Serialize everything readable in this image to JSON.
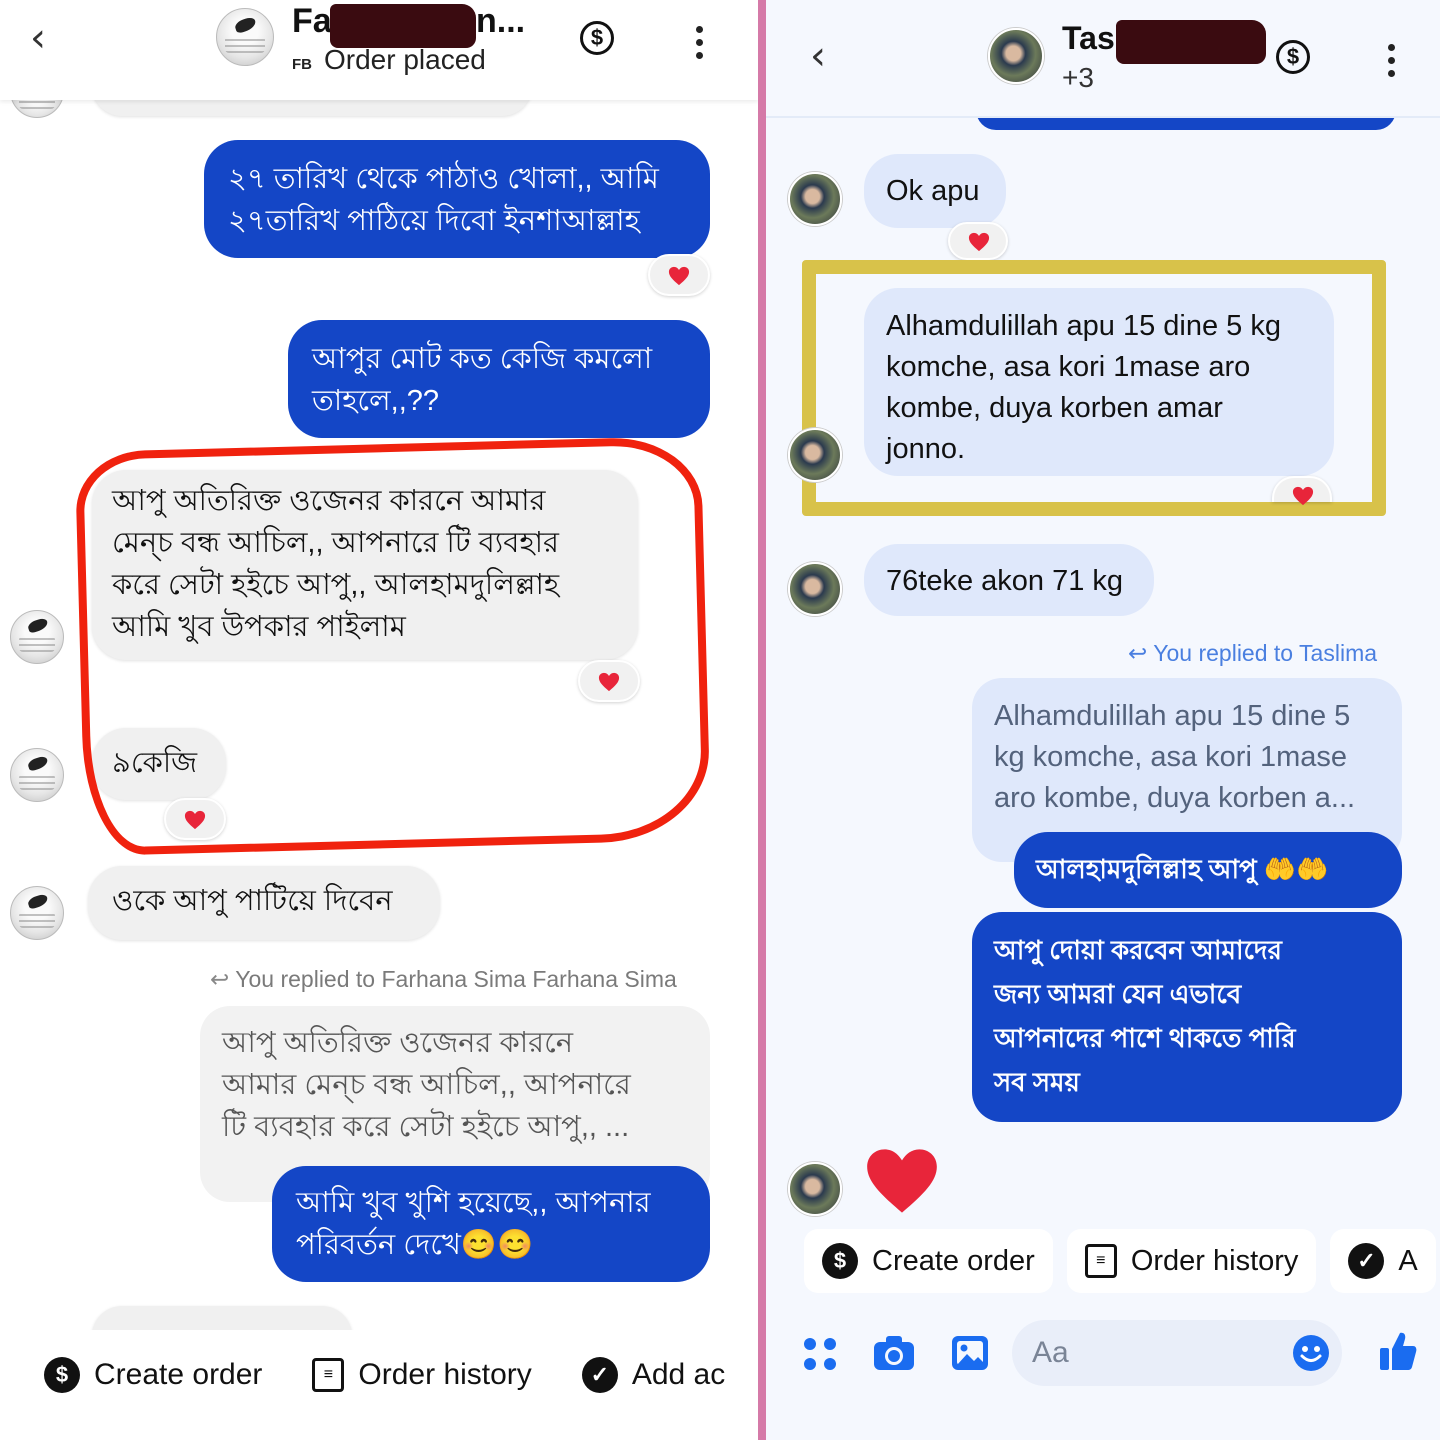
{
  "left": {
    "header": {
      "title": "Fa",
      "title_tail": "n...",
      "subtitle_prefix": "FB",
      "subtitle": "Order placed"
    },
    "messages": {
      "m1": "২৭ তারিখ থেকে পাঠাও খোলা,, আমি\n২৭তারিখ পাঠিয়ে দিবো ইনশাআল্লাহ",
      "m2": "আপুর মোট কত কেজি কমলো\nতাহলে,,??",
      "m3": "আপু অতিরিক্ত  ওজেনর কারনে আমার\nমেন্চ বন্ধ  আচিল,, আপনারে টি ব্যবহার\nকরে সেটা হইচে আপু,, আলহামদুলিল্লাহ\nআমি খুব উপকার পাইলাম",
      "m4": "৯কেজি",
      "m5": "ওকে আপু পাটিয়ে দিবেন",
      "reply_note": "You replied to Farhana Sima Farhana Sima",
      "quoted": "আপু অতিরিক্ত  ওজেনর কারনে\nআমার মেন্চ বন্ধ  আচিল,, আপনারে\nটি ব্যবহার করে সেটা হইচে আপু,, ...",
      "m6": "আমি খুব খুশি হয়েছে,, আপনার\nপরিবর্তন দেখে😊😊"
    },
    "actions": {
      "create_order": "Create order",
      "order_history": "Order history",
      "add": "Add ac"
    }
  },
  "right": {
    "header": {
      "title": "Tas",
      "subtitle": "+3"
    },
    "messages": {
      "r1": "Ok apu",
      "r2": "Alhamdulillah apu 15 dine 5 kg\nkomche, asa kori 1mase aro\nkombe, duya korben amar\njonno.",
      "r3": "76teke akon 71 kg",
      "reply_note": "You replied to Taslima",
      "quoted": "Alhamdulillah apu 15 dine 5\nkg komche, asa kori 1mase\naro kombe, duya korben a...",
      "r4": "আলহামদুলিল্লাহ আপু 🤲🤲",
      "r5": "আপু দোয়া করবেন আমাদের\nজন্য আমরা যেন এভাবে\nআপনাদের পাশে থাকতে পারি\nসব সময়"
    },
    "actions": {
      "create_order": "Create order",
      "order_history": "Order history",
      "more": "A"
    },
    "composer": {
      "placeholder": "Aa"
    }
  },
  "icons": {
    "back": "chevron-left-icon",
    "dollar": "dollar-circle-icon",
    "more": "more-vertical-icon",
    "heart": "heart-icon",
    "reply": "reply-arrow-icon",
    "apps": "apps-icon",
    "camera": "camera-icon",
    "gallery": "image-icon",
    "emoji": "emoji-icon",
    "like": "thumbs-up-icon"
  },
  "colors": {
    "outgoing_bubble": "#1446c6",
    "incoming_bubble_left": "#f0f0f0",
    "incoming_bubble_right": "#dfe8fb",
    "heart": "#e8253a",
    "annotation_red": "#f0220e",
    "annotation_yellow": "#d8c24a",
    "divider": "#d57aa8",
    "messenger_blue": "#1a6cf0"
  }
}
